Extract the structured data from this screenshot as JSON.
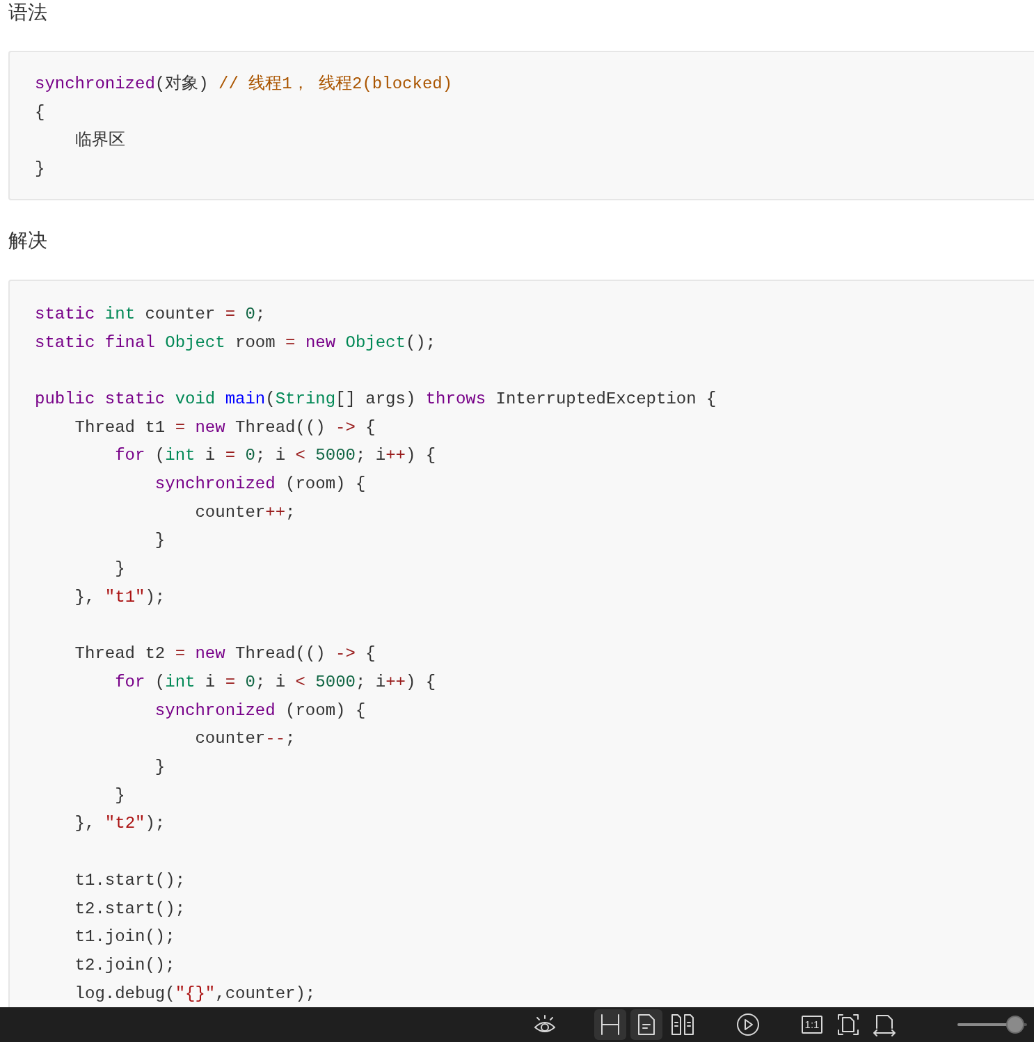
{
  "sections": [
    {
      "heading": "语法",
      "code": [
        {
          "kind": "code",
          "tokens": [
            {
              "kind": "keyword",
              "text": "synchronized"
            },
            {
              "kind": "plain",
              "text": "(对象) "
            },
            {
              "kind": "comment",
              "text": "// 线程1， 线程2(blocked)"
            }
          ]
        },
        {
          "kind": "code",
          "tokens": [
            {
              "kind": "plain",
              "text": "{"
            }
          ]
        },
        {
          "kind": "code",
          "tokens": [
            {
              "kind": "plain",
              "text": "    临界区"
            }
          ]
        },
        {
          "kind": "code",
          "tokens": [
            {
              "kind": "plain",
              "text": "}"
            }
          ]
        }
      ]
    },
    {
      "heading": "解决",
      "code": [
        {
          "kind": "code",
          "tokens": [
            {
              "kind": "keyword",
              "text": "static "
            },
            {
              "kind": "type",
              "text": "int"
            },
            {
              "kind": "plain",
              "text": " counter "
            },
            {
              "kind": "operator",
              "text": "= "
            },
            {
              "kind": "number",
              "text": "0"
            },
            {
              "kind": "plain",
              "text": ";"
            }
          ]
        },
        {
          "kind": "code",
          "tokens": [
            {
              "kind": "keyword",
              "text": "static final "
            },
            {
              "kind": "type",
              "text": "Object"
            },
            {
              "kind": "plain",
              "text": " room "
            },
            {
              "kind": "operator",
              "text": "= "
            },
            {
              "kind": "keyword",
              "text": "new "
            },
            {
              "kind": "type",
              "text": "Object"
            },
            {
              "kind": "plain",
              "text": "();"
            }
          ]
        },
        {
          "kind": "blank"
        },
        {
          "kind": "code",
          "tokens": [
            {
              "kind": "keyword",
              "text": "public static "
            },
            {
              "kind": "type",
              "text": "void "
            },
            {
              "kind": "def",
              "text": "main"
            },
            {
              "kind": "plain",
              "text": "("
            },
            {
              "kind": "type",
              "text": "String"
            },
            {
              "kind": "plain",
              "text": "[] args) "
            },
            {
              "kind": "keyword",
              "text": "throws"
            },
            {
              "kind": "plain",
              "text": " InterruptedException {"
            }
          ]
        },
        {
          "kind": "code",
          "tokens": [
            {
              "kind": "plain",
              "text": "    Thread t1 "
            },
            {
              "kind": "operator",
              "text": "= "
            },
            {
              "kind": "keyword",
              "text": "new"
            },
            {
              "kind": "plain",
              "text": " Thread(() "
            },
            {
              "kind": "operator",
              "text": "->"
            },
            {
              "kind": "plain",
              "text": " {"
            }
          ]
        },
        {
          "kind": "code",
          "tokens": [
            {
              "kind": "keyword",
              "text": "        for"
            },
            {
              "kind": "plain",
              "text": " ("
            },
            {
              "kind": "type",
              "text": "int"
            },
            {
              "kind": "plain",
              "text": " i "
            },
            {
              "kind": "operator",
              "text": "= "
            },
            {
              "kind": "number",
              "text": "0"
            },
            {
              "kind": "plain",
              "text": "; i "
            },
            {
              "kind": "operator",
              "text": "< "
            },
            {
              "kind": "number",
              "text": "5000"
            },
            {
              "kind": "plain",
              "text": "; i"
            },
            {
              "kind": "operator",
              "text": "++"
            },
            {
              "kind": "plain",
              "text": ") {"
            }
          ]
        },
        {
          "kind": "code",
          "tokens": [
            {
              "kind": "keyword",
              "text": "            synchronized"
            },
            {
              "kind": "plain",
              "text": " (room) {"
            }
          ]
        },
        {
          "kind": "code",
          "tokens": [
            {
              "kind": "plain",
              "text": "                counter"
            },
            {
              "kind": "operator",
              "text": "++"
            },
            {
              "kind": "plain",
              "text": ";"
            }
          ]
        },
        {
          "kind": "code",
          "tokens": [
            {
              "kind": "plain",
              "text": "            }"
            }
          ]
        },
        {
          "kind": "code",
          "tokens": [
            {
              "kind": "plain",
              "text": "        }"
            }
          ]
        },
        {
          "kind": "code",
          "tokens": [
            {
              "kind": "plain",
              "text": "    }, "
            },
            {
              "kind": "string",
              "text": "\"t1\""
            },
            {
              "kind": "plain",
              "text": ");"
            }
          ]
        },
        {
          "kind": "blank"
        },
        {
          "kind": "code",
          "tokens": [
            {
              "kind": "plain",
              "text": "    Thread t2 "
            },
            {
              "kind": "operator",
              "text": "= "
            },
            {
              "kind": "keyword",
              "text": "new"
            },
            {
              "kind": "plain",
              "text": " Thread(() "
            },
            {
              "kind": "operator",
              "text": "->"
            },
            {
              "kind": "plain",
              "text": " {"
            }
          ]
        },
        {
          "kind": "code",
          "tokens": [
            {
              "kind": "keyword",
              "text": "        for"
            },
            {
              "kind": "plain",
              "text": " ("
            },
            {
              "kind": "type",
              "text": "int"
            },
            {
              "kind": "plain",
              "text": " i "
            },
            {
              "kind": "operator",
              "text": "= "
            },
            {
              "kind": "number",
              "text": "0"
            },
            {
              "kind": "plain",
              "text": "; i "
            },
            {
              "kind": "operator",
              "text": "< "
            },
            {
              "kind": "number",
              "text": "5000"
            },
            {
              "kind": "plain",
              "text": "; i"
            },
            {
              "kind": "operator",
              "text": "++"
            },
            {
              "kind": "plain",
              "text": ") {"
            }
          ]
        },
        {
          "kind": "code",
          "tokens": [
            {
              "kind": "keyword",
              "text": "            synchronized"
            },
            {
              "kind": "plain",
              "text": " (room) {"
            }
          ]
        },
        {
          "kind": "code",
          "tokens": [
            {
              "kind": "plain",
              "text": "                counter"
            },
            {
              "kind": "operator",
              "text": "--"
            },
            {
              "kind": "plain",
              "text": ";"
            }
          ]
        },
        {
          "kind": "code",
          "tokens": [
            {
              "kind": "plain",
              "text": "            }"
            }
          ]
        },
        {
          "kind": "code",
          "tokens": [
            {
              "kind": "plain",
              "text": "        }"
            }
          ]
        },
        {
          "kind": "code",
          "tokens": [
            {
              "kind": "plain",
              "text": "    }, "
            },
            {
              "kind": "string",
              "text": "\"t2\""
            },
            {
              "kind": "plain",
              "text": ");"
            }
          ]
        },
        {
          "kind": "blank"
        },
        {
          "kind": "code",
          "tokens": [
            {
              "kind": "plain",
              "text": "    t1.start();"
            }
          ]
        },
        {
          "kind": "code",
          "tokens": [
            {
              "kind": "plain",
              "text": "    t2.start();"
            }
          ]
        },
        {
          "kind": "code",
          "tokens": [
            {
              "kind": "plain",
              "text": "    t1.join();"
            }
          ]
        },
        {
          "kind": "code",
          "tokens": [
            {
              "kind": "plain",
              "text": "    t2.join();"
            }
          ]
        },
        {
          "kind": "code",
          "tokens": [
            {
              "kind": "plain",
              "text": "    log.debug("
            },
            {
              "kind": "string",
              "text": "\"{}\""
            },
            {
              "kind": "plain",
              "text": ",counter);"
            }
          ]
        }
      ]
    }
  ],
  "toolbar": {
    "items": [
      {
        "kind": "eye",
        "selected": false
      },
      {
        "kind": "split",
        "selected": true
      },
      {
        "kind": "page",
        "selected": true
      },
      {
        "kind": "two-pages",
        "selected": false
      },
      {
        "kind": "play",
        "selected": false
      },
      {
        "kind": "ratio",
        "label": "1:1",
        "selected": false
      },
      {
        "kind": "fit-page",
        "selected": false
      },
      {
        "kind": "fit-width",
        "selected": false
      }
    ],
    "zoom_slider": {
      "level": 0.83
    }
  }
}
